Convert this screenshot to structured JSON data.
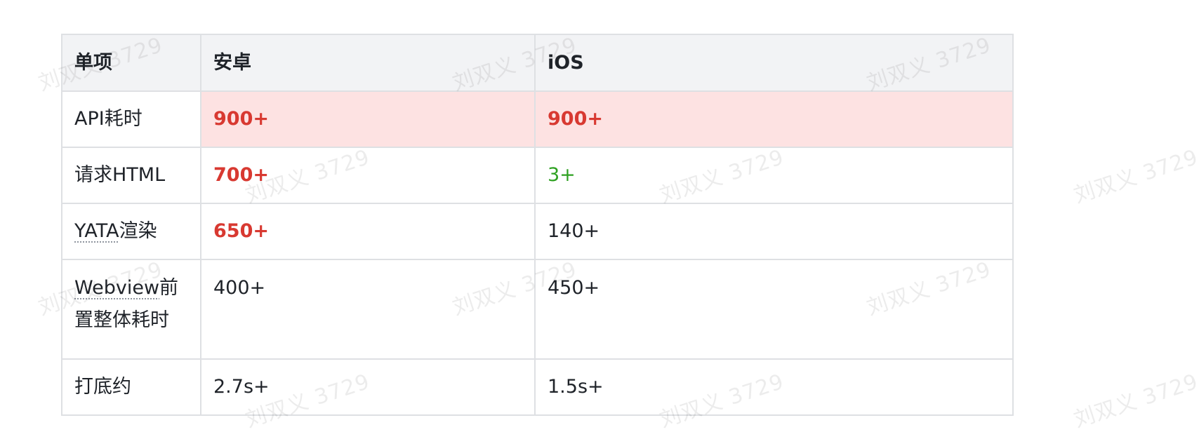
{
  "table": {
    "headers": [
      "单项",
      "安卓",
      "iOS"
    ],
    "rows": [
      {
        "item": "API耗时",
        "android": "900+",
        "ios": "900+"
      },
      {
        "item": "请求HTML",
        "android": "700+",
        "ios": "3+"
      },
      {
        "item_underlined": "YATA",
        "item_rest": "渲染",
        "android": "650+",
        "ios": "140+"
      },
      {
        "item_underlined": "Webview",
        "item_rest": "前置整体耗时",
        "android": "400+",
        "ios": "450+"
      },
      {
        "item": "打底约",
        "android": "2.7s+",
        "ios": "1.5s+"
      }
    ]
  },
  "watermark": {
    "text": "刘双义 3729"
  },
  "colors": {
    "header_bg": "#f2f3f5",
    "highlight_row_bg": "#fde2e2",
    "red_value": "#d83931",
    "green_value": "#2ea121",
    "border": "#dee0e3"
  }
}
